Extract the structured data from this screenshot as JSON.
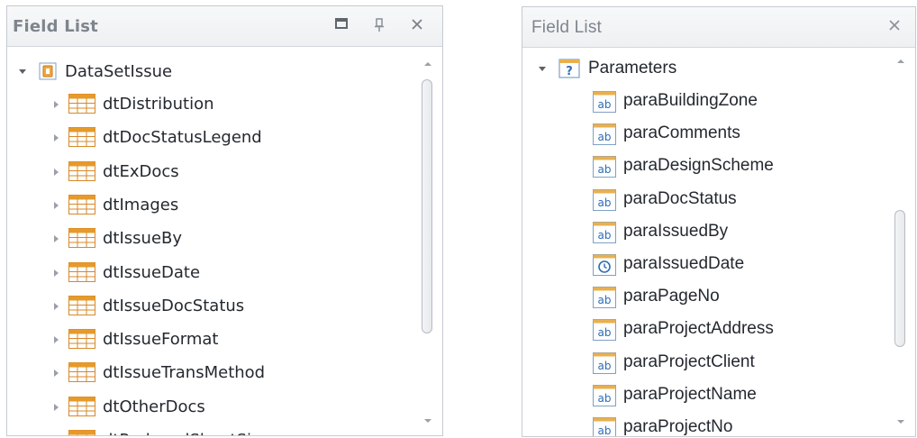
{
  "left_panel": {
    "title": "Field List",
    "buttons": {
      "maximize": "maximize-icon",
      "pin": "pin-icon",
      "close": "close-icon"
    },
    "root": {
      "label": "DataSetIssue",
      "expanded": true,
      "icon": "dataset-icon"
    },
    "items": [
      {
        "label": "dtDistribution"
      },
      {
        "label": "dtDocStatusLegend"
      },
      {
        "label": "dtExDocs"
      },
      {
        "label": "dtImages"
      },
      {
        "label": "dtIssueBy"
      },
      {
        "label": "dtIssueDate"
      },
      {
        "label": "dtIssueDocStatus"
      },
      {
        "label": "dtIssueFormat"
      },
      {
        "label": "dtIssueTransMethod"
      },
      {
        "label": "dtOtherDocs"
      },
      {
        "label": "dtReducedSheetSize"
      }
    ]
  },
  "right_panel": {
    "title": "Field List",
    "buttons": {
      "close": "close-icon"
    },
    "root": {
      "label": "Parameters",
      "expanded": true,
      "icon": "parameters-icon"
    },
    "items": [
      {
        "label": "paraBuildingZone",
        "type": "string"
      },
      {
        "label": "paraComments",
        "type": "string"
      },
      {
        "label": "paraDesignScheme",
        "type": "string"
      },
      {
        "label": "paraDocStatus",
        "type": "string"
      },
      {
        "label": "paraIssuedBy",
        "type": "string"
      },
      {
        "label": "paraIssuedDate",
        "type": "datetime"
      },
      {
        "label": "paraPageNo",
        "type": "string"
      },
      {
        "label": "paraProjectAddress",
        "type": "string"
      },
      {
        "label": "paraProjectClient",
        "type": "string"
      },
      {
        "label": "paraProjectName",
        "type": "string"
      },
      {
        "label": "paraProjectNo",
        "type": "string"
      }
    ]
  },
  "colors": {
    "tableIcon": "#e69a2a",
    "border": "#c5cbd3",
    "text": "#24292f",
    "titleText": "#7e858d"
  }
}
